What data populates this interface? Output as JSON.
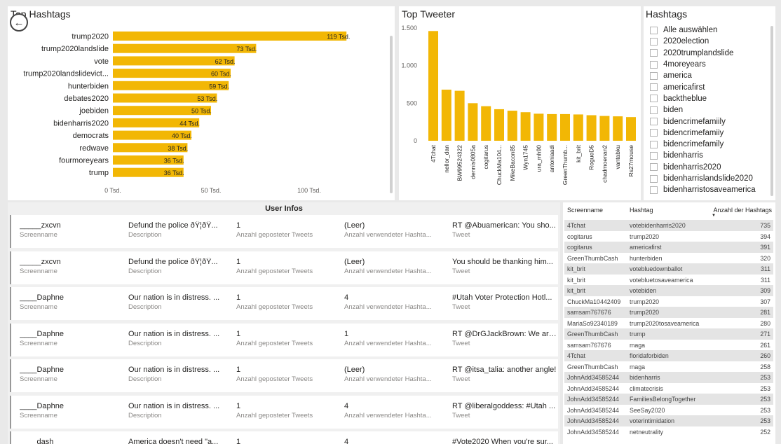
{
  "hashtags_panel": {
    "title": "Top Hashtags"
  },
  "tweeter_panel": {
    "title": "Top Tweeter"
  },
  "chart_data": [
    {
      "type": "bar",
      "orientation": "horizontal",
      "title": "Top Hashtags",
      "color": "#f2b705",
      "categories": [
        "trump2020",
        "trump2020landslide",
        "vote",
        "trump2020landslidevict...",
        "hunterbiden",
        "debates2020",
        "joebiden",
        "bidenharris2020",
        "democrats",
        "redwave",
        "fourmoreyears",
        "trump"
      ],
      "values": [
        119,
        73,
        62,
        60,
        59,
        53,
        50,
        44,
        40,
        38,
        36,
        36
      ],
      "value_labels": [
        "119 Tsd.",
        "73 Tsd.",
        "62 Tsd.",
        "60 Tsd.",
        "59 Tsd.",
        "53 Tsd.",
        "50 Tsd.",
        "44 Tsd.",
        "40 Tsd.",
        "38 Tsd.",
        "36 Tsd.",
        "36 Tsd."
      ],
      "xlim": [
        0,
        119
      ],
      "xticks": [
        0,
        50,
        100
      ],
      "xtick_labels": [
        "0 Tsd.",
        "50 Tsd.",
        "100 Tsd."
      ],
      "grid": false
    },
    {
      "type": "bar",
      "title": "Top Tweeter",
      "color": "#f2b705",
      "categories": [
        "4Tchat",
        "nellor_dan",
        "BW99524322",
        "dennis0805a",
        "cogitarus",
        "ChuckMa104...",
        "MikeBacon85",
        "Wyn1745",
        "ura_mh90",
        "antoniaadi",
        "GreenThumb...",
        "kit_brit",
        "RogueD5",
        "chadmoenan2",
        "vantabku",
        "Rs27mouse"
      ],
      "values": [
        1460,
        680,
        665,
        500,
        460,
        420,
        400,
        380,
        360,
        355,
        355,
        350,
        340,
        330,
        325,
        315
      ],
      "ylim": [
        0,
        1500
      ],
      "yticks": [
        0,
        500,
        1000,
        1500
      ],
      "ytick_labels": [
        "0",
        "500",
        "1.000",
        "1.500"
      ],
      "grid": false
    }
  ],
  "slicer": {
    "title": "Hashtags",
    "items": [
      "Alle auswählen",
      "2020election",
      "2020trumplandslide",
      "4moreyears",
      "america",
      "americafirst",
      "backtheblue",
      "biden",
      "bidencrimefamiily",
      "bidencrimefamiiy",
      "bidencrimefamily",
      "bidenharris",
      "bidenharris2020",
      "bidenharrislandslide2020",
      "bidenharristosaveamerica"
    ]
  },
  "user_infos": {
    "title": "User Infos",
    "labels": {
      "screenname": "Screenname",
      "description": "Description",
      "tweets": "Anzahl geposteter Tweets",
      "hashtags": "Anzahl verwendeter Hashta...",
      "tweet": "Tweet"
    },
    "cards": [
      {
        "screenname": "_____zxcvn",
        "description": "Defund the police ðŸ¦ðŸ...",
        "tweets": "1",
        "hashtags": "(Leer)",
        "tweet": "RT @Abuamerican: You sho..."
      },
      {
        "screenname": "_____zxcvn",
        "description": "Defund the police ðŸ¦ðŸ...",
        "tweets": "1",
        "hashtags": "(Leer)",
        "tweet": "You should be thanking him..."
      },
      {
        "screenname": "____Daphne",
        "description": "Our nation is in distress. ...",
        "tweets": "1",
        "hashtags": "4",
        "tweet": "#Utah Voter Protection Hotl..."
      },
      {
        "screenname": "____Daphne",
        "description": "Our nation is in distress. ...",
        "tweets": "1",
        "hashtags": "1",
        "tweet": "RT @DrGJackBrown: We are ..."
      },
      {
        "screenname": "____Daphne",
        "description": "Our nation is in distress. ...",
        "tweets": "1",
        "hashtags": "(Leer)",
        "tweet": "RT @itsa_talia: another angle!"
      },
      {
        "screenname": "____Daphne",
        "description": "Our nation is in distress. ...",
        "tweets": "1",
        "hashtags": "4",
        "tweet": "RT @liberalgoddess: #Utah ..."
      },
      {
        "screenname": "____dash____",
        "description": "America doesn't need \"a...",
        "tweets": "1",
        "hashtags": "4",
        "tweet": "#Vote2020 When you're sur..."
      }
    ]
  },
  "table": {
    "headers": {
      "screenname": "Screenname",
      "hashtag": "Hashtag",
      "count": "Anzahl der Hashtags"
    },
    "rows": [
      [
        "4Tchat",
        "votebidenharris2020",
        "735"
      ],
      [
        "cogitarus",
        "trump2020",
        "394"
      ],
      [
        "cogitarus",
        "americafirst",
        "391"
      ],
      [
        "GreenThumbCash",
        "hunterbiden",
        "320"
      ],
      [
        "kit_brit",
        "votebluedownballot",
        "311"
      ],
      [
        "kit_brit",
        "votebluetosaveamerica",
        "311"
      ],
      [
        "kit_brit",
        "votebiden",
        "309"
      ],
      [
        "ChuckMa10442409",
        "trump2020",
        "307"
      ],
      [
        "samsam767676",
        "trump2020",
        "281"
      ],
      [
        "MariaSo92340189",
        "trump2020tosaveamerica",
        "280"
      ],
      [
        "GreenThumbCash",
        "trump",
        "271"
      ],
      [
        "samsam767676",
        "maga",
        "261"
      ],
      [
        "4Tchat",
        "floridaforbiden",
        "260"
      ],
      [
        "GreenThumbCash",
        "maga",
        "258"
      ],
      [
        "JohnAdd34585244",
        "bidenharris",
        "253"
      ],
      [
        "JohnAdd34585244",
        "climatecrisis",
        "253"
      ],
      [
        "JohnAdd34585244",
        "FamiliesBelongTogether",
        "253"
      ],
      [
        "JohnAdd34585244",
        "SeeSay2020",
        "253"
      ],
      [
        "JohnAdd34585244",
        "voterintimidation",
        "253"
      ],
      [
        "JohnAdd34585244",
        "netneutrality",
        "252"
      ]
    ]
  }
}
